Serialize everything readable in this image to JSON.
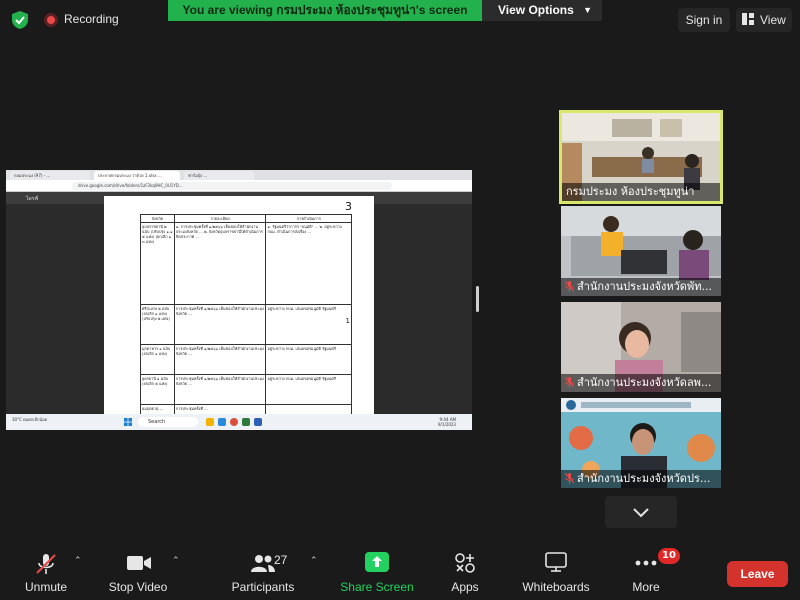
{
  "top": {
    "recording_label": "Recording",
    "viewing_banner": "You are viewing กรมประมง ห้องประชุมทูน่า's screen",
    "view_options_label": "View Options",
    "signin_label": "Sign in",
    "view_label": "View"
  },
  "shared_screen": {
    "tabs": [
      "กลมประมง (97) - ...",
      "ประกาศกรมประมง ว่าด้วย 1.xlsx ...",
      "ฟาร์มบุ้ง ..."
    ],
    "url": "drive.google.com/drive/folders/1zF2kq9HC_0U1YD...",
    "drive_title": "ไดรฟ์",
    "page_number": "3",
    "table_headers": [
      "จังหวัด",
      "รายละเอียด",
      "การดำเนินการ"
    ],
    "table_rows": [
      [
        "อุบลราชธานี ๒ ฉบับ (ปรับปรุง ๑,๑ ๕ แห่ง) (ยกเลิก ๑ ๓ แห่ง)",
        "๑. การประชุมครั้งที่ ๑/๒๕๖๖ เห็นชอบให้สำนักงานประมงจังหวัด ... ๒. จังหวัดอุบลราชธานีได้ดำเนินการปิดประกาศ ...",
        "๑. รัฐมนตรีว่าการฯ \"อนุมัติ\" ... ๒. อยู่ระหว่าง กบม. ดำเนินการส่งเรื่อง ..."
      ],
      [
        "ศรีสะเกษ ๒ ฉบับ (ยกเลิก ๑ แห่ง) (ปรับปรุง ๒ แห่ง)",
        "การประชุมครั้งที่ ๑/๒๕๖๖ เห็นชอบให้สำนักงานประมงจังหวัด ...",
        "อยู่ระหว่าง กบม. เสนอขอรมนูมัติ รัฐมนตรี"
      ],
      [
        "มุกดาหาร ๑ ฉบับ (ยกเลิก ๑ แห่ง)",
        "การประชุมครั้งที่ ๑/๒๕๖๖ เห็นชอบให้สำนักงานประมงจังหวัด ...",
        "อยู่ระหว่าง กบม. เสนอขอรมนูมัติ รัฐมนตรี"
      ],
      [
        "อุดรธานี ๑ ฉบับ (ยกเลิก ๕ แห่ง)",
        "การประชุมครั้งที่ ๑/๒๕๖๖ เห็นชอบให้สำนักงานประมงจังหวัด ...",
        "อยู่ระหว่าง กบม. เสนอขอรมนูมัติ รัฐมนตรี"
      ],
      [
        "อมฤตธาตุ ...",
        "การประชุมครั้งที่ ...",
        ""
      ]
    ],
    "side_note": "1",
    "taskbar_weather": "30°C ฝนตกเล็กน้อย",
    "taskbar_search": "Search",
    "taskbar_time": "9:44 AM",
    "taskbar_date": "9/1/2023"
  },
  "tiles": [
    {
      "name": "กรมประมง ห้องประชุมทูน่า",
      "muted": false
    },
    {
      "name": "สำนักงานประมงจังหวัดพัท...",
      "muted": true
    },
    {
      "name": "สำนักงานประมงจังหวัดลพ...",
      "muted": true
    },
    {
      "name": "สำนักงานประมงจังหวัดปร...",
      "muted": true
    }
  ],
  "toolbar": {
    "unmute": "Unmute",
    "stop_video": "Stop Video",
    "participants": "Participants",
    "participants_count": "27",
    "share_screen": "Share Screen",
    "apps": "Apps",
    "whiteboards": "Whiteboards",
    "more": "More",
    "more_badge": "10",
    "leave": "Leave"
  },
  "colors": {
    "banner_green": "#23b14d",
    "share_green": "#23d160",
    "leave_red": "#d4322c",
    "active_speaker": "#d7e86a"
  }
}
